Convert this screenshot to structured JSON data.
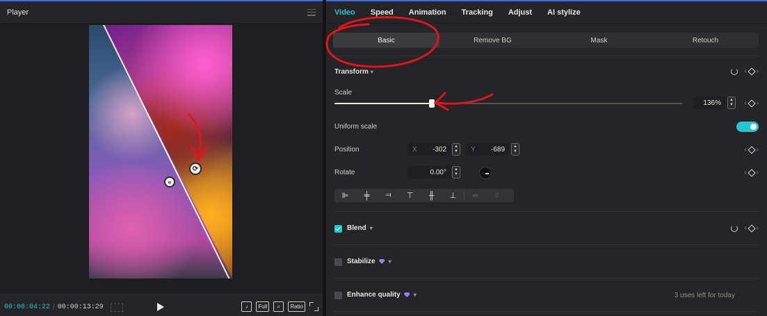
{
  "player": {
    "title": "Player",
    "time_current": "00:00:04:22",
    "time_separator": "/",
    "time_total": "00:00:13:29",
    "buttons": {
      "tiktok": "♪",
      "full": "Full",
      "ratio": "Ratio"
    }
  },
  "inspector": {
    "tabs": [
      {
        "label": "Video",
        "active": true
      },
      {
        "label": "Speed",
        "active": false
      },
      {
        "label": "Animation",
        "active": false
      },
      {
        "label": "Tracking",
        "active": false
      },
      {
        "label": "Adjust",
        "active": false
      },
      {
        "label": "AI stylize",
        "active": false
      }
    ],
    "subtabs": [
      {
        "label": "Basic",
        "active": true
      },
      {
        "label": "Remove BG",
        "active": false
      },
      {
        "label": "Mask",
        "active": false
      },
      {
        "label": "Retouch",
        "active": false
      }
    ],
    "transform": {
      "title": "Transform",
      "scale_label": "Scale",
      "scale_value": "136%",
      "scale_fraction": 0.28,
      "uniform_scale_label": "Uniform scale",
      "uniform_scale_on": true,
      "position_label": "Position",
      "position_x_prefix": "X",
      "position_x": "-302",
      "position_y_prefix": "Y",
      "position_y": "-689",
      "rotate_label": "Rotate",
      "rotate_value": "0.00°"
    },
    "blend": {
      "label": "Blend",
      "checked": true
    },
    "stabilize": {
      "label": "Stabilize",
      "checked": false
    },
    "enhance": {
      "label": "Enhance quality",
      "checked": false,
      "uses_left": "3 uses left for today"
    }
  },
  "colors": {
    "accent": "#22c5d0",
    "annotation": "#e0141e"
  }
}
